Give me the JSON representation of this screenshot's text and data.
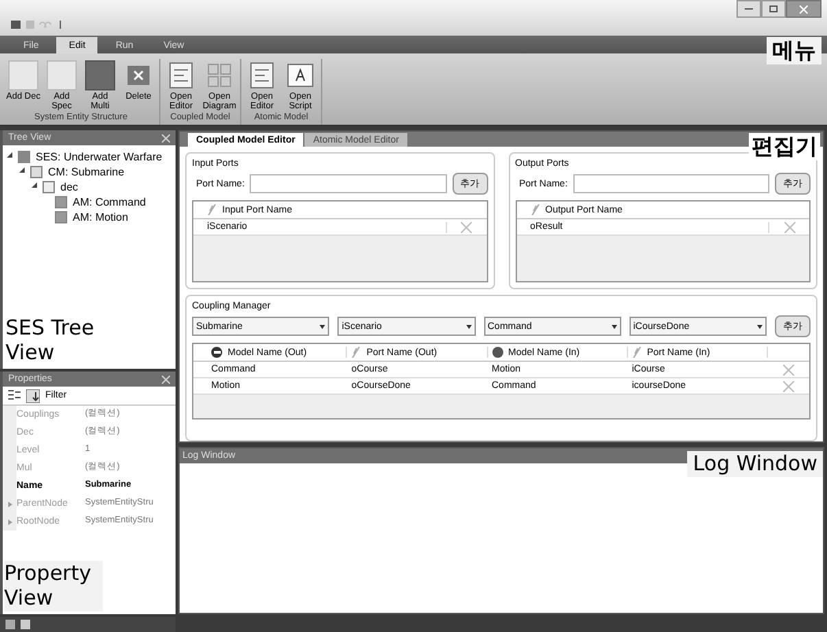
{
  "menu_tabs": [
    {
      "label": "File",
      "selected": false
    },
    {
      "label": "Edit",
      "selected": true
    },
    {
      "label": "Run",
      "selected": false
    },
    {
      "label": "View",
      "selected": false
    }
  ],
  "ribbon_groups": [
    {
      "label": "System Entity Structure",
      "buttons": [
        {
          "label": "Add Dec",
          "kind": "light"
        },
        {
          "label": "Add Spec",
          "kind": "light"
        },
        {
          "label": "Add Multi",
          "kind": "dark"
        },
        {
          "label": "Delete",
          "kind": "delete"
        }
      ]
    },
    {
      "label": "Coupled Model",
      "buttons": [
        {
          "label": "Open Editor",
          "kind": "editor"
        },
        {
          "label": "Open Diagram",
          "kind": "diagram"
        }
      ]
    },
    {
      "label": "Atomic Model",
      "buttons": [
        {
          "label": "Open Editor",
          "kind": "editor"
        },
        {
          "label": "Open Script",
          "kind": "script"
        }
      ]
    }
  ],
  "menu_annotation": "메뉴",
  "tree_view": {
    "title": "Tree View",
    "items": [
      {
        "label": "SES: Underwater Warfare",
        "kind": "ses",
        "children": [
          {
            "label": "CM: Submarine",
            "kind": "cm",
            "children": [
              {
                "label": "dec",
                "kind": "dec",
                "children": [
                  {
                    "label": "AM: Command",
                    "kind": "am"
                  },
                  {
                    "label": "AM: Motion",
                    "kind": "am"
                  }
                ]
              }
            ]
          }
        ]
      }
    ],
    "annotation": "SES Tree View"
  },
  "properties": {
    "title": "Properties",
    "filter": "Filter",
    "rows": [
      {
        "name": "Couplings",
        "value": "(컬렉션)",
        "bold": false,
        "expandable": false
      },
      {
        "name": "Dec",
        "value": "(컬렉션)",
        "bold": false,
        "expandable": false
      },
      {
        "name": "Level",
        "value": "1",
        "bold": false,
        "expandable": false
      },
      {
        "name": "Mul",
        "value": "(컬렉션)",
        "bold": false,
        "expandable": false
      },
      {
        "name": "Name",
        "value": "Submarine",
        "bold": true,
        "expandable": false
      },
      {
        "name": "ParentNode",
        "value": "SystemEntityStru",
        "bold": false,
        "expandable": true
      },
      {
        "name": "RootNode",
        "value": "SystemEntityStru",
        "bold": false,
        "expandable": true
      }
    ],
    "annotation": "Property View"
  },
  "editor": {
    "tabs": [
      {
        "label": "Coupled Model Editor",
        "selected": true
      },
      {
        "label": "Atomic Model Editor",
        "selected": false
      }
    ],
    "annotation": "편집기",
    "port_groups": [
      {
        "title": "Input Ports",
        "field_label": "Port Name:",
        "add_button": "추가",
        "column": "Input Port Name",
        "rows": [
          "iScenario"
        ]
      },
      {
        "title": "Output Ports",
        "field_label": "Port Name:",
        "add_button": "추가",
        "column": "Output Port Name",
        "rows": [
          "oResult"
        ]
      }
    ],
    "coupling_manager": {
      "title": "Coupling Manager",
      "selects": [
        "Submarine",
        "iScenario",
        "Command",
        "iCourseDone"
      ],
      "add_button": "추가",
      "columns": [
        {
          "label": "Model Name (Out)",
          "kind": "out"
        },
        {
          "label": "Port Name (Out)",
          "kind": "port"
        },
        {
          "label": "Model Name (In)",
          "kind": "in"
        },
        {
          "label": "Port Name (In)",
          "kind": "port"
        }
      ],
      "rows": [
        [
          "Command",
          "oCourse",
          "Motion",
          "iCourse"
        ],
        [
          "Motion",
          "oCourseDone",
          "Command",
          "icourseDone"
        ]
      ]
    }
  },
  "log_window": {
    "title": "Log Window",
    "annotation": "Log Window"
  }
}
